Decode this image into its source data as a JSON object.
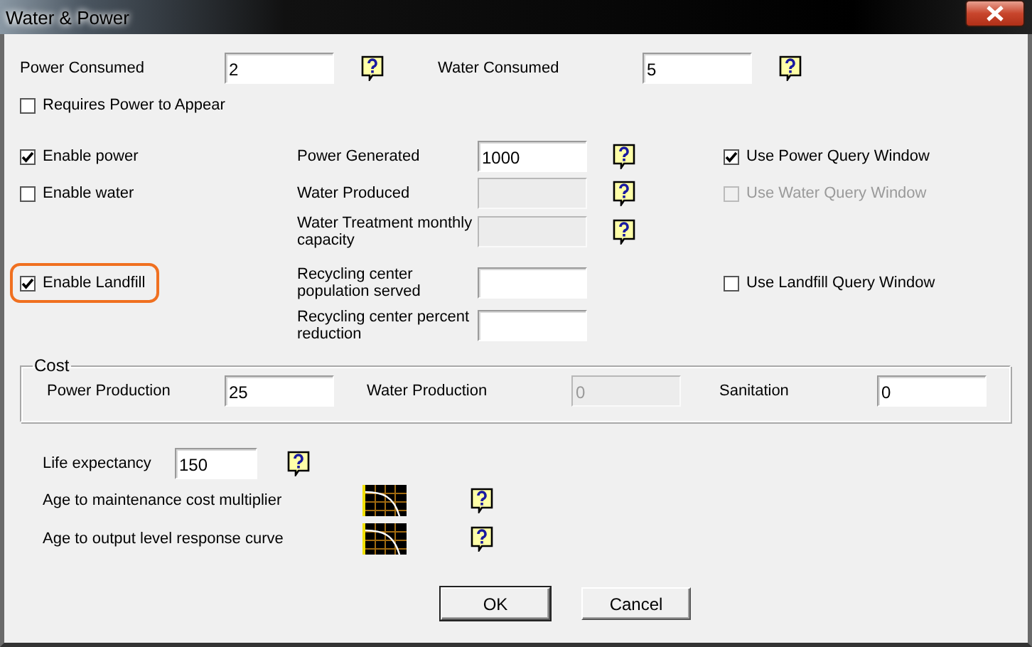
{
  "window": {
    "title": "Water & Power"
  },
  "consumption": [
    {
      "label": "Power Consumed",
      "value": "2"
    },
    {
      "label": "Water Consumed",
      "value": "5"
    }
  ],
  "requires_power": {
    "label": "Requires Power to Appear",
    "checked": false
  },
  "rows": [
    {
      "toggle": {
        "label": "Enable power",
        "checked": true,
        "highlighted": false
      },
      "label": "Power Generated",
      "field": {
        "value": "1000",
        "disabled": false
      },
      "help": true,
      "query": {
        "label": "Use Power Query Window",
        "checked": true,
        "disabled": false
      }
    },
    {
      "toggle": {
        "label": "Enable water",
        "checked": false,
        "highlighted": false
      },
      "label": "Water Produced",
      "field": {
        "disabled": true
      },
      "help": true,
      "query": {
        "label": "Use Water Query Window",
        "checked": false,
        "disabled": true
      }
    },
    {
      "label": "Water Treatment monthly capacity",
      "field": {
        "disabled": true
      },
      "help": true
    },
    {
      "toggle": {
        "label": "Enable Landfill",
        "checked": true,
        "highlighted": true
      },
      "label": "Recycling center population served",
      "field": {
        "disabled": false
      },
      "help": false,
      "query": {
        "label": "Use Landfill Query Window",
        "checked": false,
        "disabled": false
      }
    },
    {
      "label": "Recycling center percent reduction",
      "field": {
        "disabled": false
      },
      "help": false
    }
  ],
  "cost": {
    "title": "Cost",
    "fields": [
      {
        "label": "Power Production",
        "value": "25",
        "disabled": false
      },
      {
        "label": "Water Production",
        "value": "0",
        "disabled": true
      },
      {
        "label": "Sanitation",
        "value": "0",
        "disabled": false
      }
    ]
  },
  "life_expectancy": {
    "label": "Life expectancy",
    "value": "150"
  },
  "curves": [
    {
      "label": "Age to maintenance cost multiplier"
    },
    {
      "label": "Age to output level response curve"
    }
  ],
  "buttons": [
    {
      "label": "OK",
      "default": true
    },
    {
      "label": "Cancel",
      "default": false
    }
  ]
}
